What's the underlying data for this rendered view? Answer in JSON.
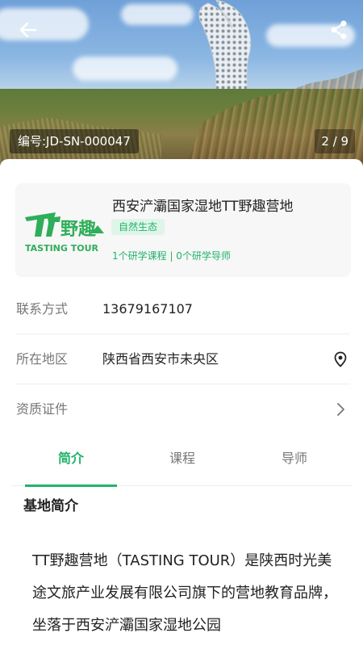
{
  "hero": {
    "code": "编号:JD-SN-000047",
    "page_counter": "2 / 9",
    "back_icon": "arrow-left-icon",
    "share_icon": "share-icon"
  },
  "base": {
    "name": "西安浐灞国家湿地TT野趣营地",
    "tag": "自然生态",
    "meta": "1个研学课程 | 0个研学导师",
    "logo_text": "TT野趣",
    "logo_subtext": "TASTING TOUR"
  },
  "contact": {
    "label": "联系方式",
    "value": "13679167107"
  },
  "region": {
    "label": "所在地区",
    "value": "陕西省西安市未央区",
    "icon": "location-pin-icon"
  },
  "certificate": {
    "label": "资质证件",
    "icon": "chevron-right-icon"
  },
  "tabs": [
    {
      "label": "简介",
      "active": true
    },
    {
      "label": "课程",
      "active": false
    },
    {
      "label": "导师",
      "active": false
    }
  ],
  "intro": {
    "title": "基地简介",
    "text": "TT野趣营地（TASTING TOUR）是陕西时光美途文旅产业发展有限公司旗下的营地教育品牌，坐落于西安浐灞国家湿地公园"
  },
  "colors": {
    "accent": "#23b26d",
    "tag_bg": "#dff5e9"
  }
}
